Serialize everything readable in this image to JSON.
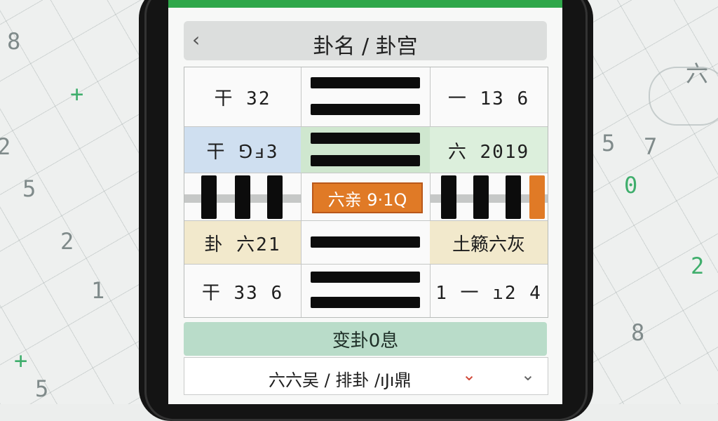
{
  "background": {
    "glyphs": [
      "8",
      "+",
      "2",
      "5",
      "2",
      "1",
      "+",
      "5",
      "5",
      "7",
      "0",
      "2",
      "六",
      "8",
      "+"
    ]
  },
  "header": {
    "back_icon": "chevron-left-icon",
    "title": "卦名 / 卦宫"
  },
  "rows": [
    {
      "left": "干 32",
      "right": "一 13 6"
    },
    {
      "left": "干 ⅁ⅎ3",
      "right": "六 2019"
    },
    {
      "center_badge": "六亲 9·1Q"
    },
    {
      "left": "卦 六21",
      "right": "土籁六灰"
    },
    {
      "left": "干 33 6",
      "right": "1 一 ı2 4"
    }
  ],
  "change": {
    "title": "变卦0息",
    "dropdown_value": "六六吴 / 排卦 /ıJı鼎",
    "dropdown_mark": "⌄",
    "chevron_icon": "chevron-down-icon"
  },
  "colors": {
    "status_bar": "#2fa74a",
    "row2_left": "#cfdff0",
    "row2_center": "#cfe7cf",
    "row2_right": "#dcefdc",
    "row4_left": "#f2e9cc",
    "row4_right": "#f2e9cc",
    "badge": "#e07a26",
    "change_header": "#b9dcc9"
  }
}
